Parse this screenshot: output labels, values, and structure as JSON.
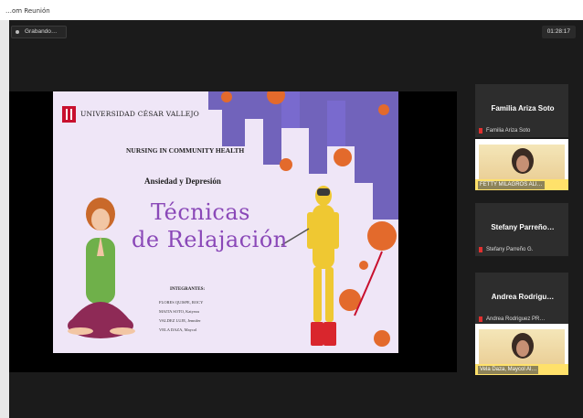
{
  "window": {
    "title": "…om Reunión"
  },
  "toolbar": {
    "recording_label": "Grabando…",
    "timer": "01:28:17"
  },
  "slide": {
    "university": "UNIVERSIDAD CÉSAR VALLEJO",
    "course": "NURSING IN COMMUNITY HEALTH",
    "subtitle": "Ansiedad y Depresión",
    "title_line1": "Técnicas",
    "title_line2": "de Relajación",
    "members_heading": "INTEGRANTES:",
    "members": [
      "FLORES QUISPE, ROCY",
      "MAITA SOTO, Katyeza",
      "VALDEZ LUJE, Jennifer",
      "VELA DAZA, Maycol"
    ]
  },
  "participants": [
    {
      "display": "Familia Ariza Soto",
      "subtitle": "Familia Ariza Soto"
    },
    {
      "video_name": "FETTY MILAGROS ALI…"
    },
    {
      "display": "Stefany Parreño…",
      "subtitle": "Stefany Parreño G."
    },
    {
      "display": "Andrea Rodrigu…",
      "subtitle": "Andrea Rodriguez PR…"
    },
    {
      "video_name": "Vela Daza, Maycol Al…"
    }
  ],
  "colors": {
    "app_bg": "#1b1b1b",
    "tile_bg": "#2d2d2d",
    "slide_accent": "#8a48b8",
    "mic_muted": "#e0302f"
  }
}
